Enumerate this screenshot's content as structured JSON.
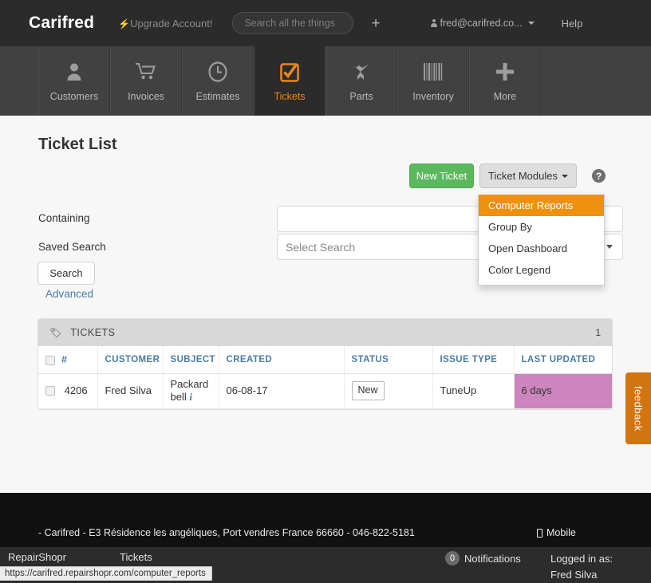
{
  "header": {
    "brand": "Carifred",
    "upgrade_label": "Upgrade Account!",
    "search_placeholder": "Search all the things",
    "plus_label": "+",
    "account_email": "fred@carifred.co...",
    "help_label": "Help"
  },
  "nav": {
    "items": [
      {
        "label": "Customers",
        "icon": "user-icon",
        "active": false
      },
      {
        "label": "Invoices",
        "icon": "cart-icon",
        "active": false
      },
      {
        "label": "Estimates",
        "icon": "clock-icon",
        "active": false
      },
      {
        "label": "Tickets",
        "icon": "checked-box-icon",
        "active": true
      },
      {
        "label": "Parts",
        "icon": "airplane-icon",
        "active": false
      },
      {
        "label": "Inventory",
        "icon": "barcode-icon",
        "active": false
      },
      {
        "label": "More",
        "icon": "plus-icon",
        "active": false
      }
    ]
  },
  "main": {
    "page_title": "Ticket List",
    "new_ticket_label": "New Ticket",
    "ticket_modules_label": "Ticket Modules",
    "help_icon_label": "?",
    "dropdown": {
      "items": [
        {
          "label": "Computer Reports",
          "highlighted": true
        },
        {
          "label": "Group By",
          "highlighted": false
        },
        {
          "label": "Open Dashboard",
          "highlighted": false
        },
        {
          "label": "Color Legend",
          "highlighted": false
        }
      ]
    },
    "form": {
      "containing_label": "Containing",
      "containing_value": "",
      "containing_placeholder": "",
      "saved_search_label": "Saved Search",
      "saved_search_value": "Select Search",
      "search_button": "Search",
      "advanced_link": "Advanced"
    },
    "panel": {
      "title": "TICKETS",
      "count": "1",
      "columns": [
        "#",
        "CUSTOMER",
        "SUBJECT",
        "CREATED",
        "STATUS",
        "ISSUE TYPE",
        "LAST UPDATED"
      ],
      "rows": [
        {
          "number": "4206",
          "customer": "Fred Silva",
          "subject": "Packard bell",
          "created": "06-08-17",
          "status": "New",
          "issue_type": "TuneUp",
          "last_updated": "6 days"
        }
      ]
    },
    "feedback_label": "feedback"
  },
  "footer": {
    "address": "- Carifred - E3 Résidence les angéliques, Port vendres France 66660 - 046-822-5181",
    "mobile_label": "Mobile"
  },
  "statusbar": {
    "app_name": "RepairShopr",
    "tab_name": "Tickets",
    "notifications_count": "0",
    "notifications_label": "Notifications",
    "logged_in_label": "Logged in as:",
    "logged_in_user": "Fred Silva",
    "link_url": "https://carifred.repairshopr.com/computer_reports"
  },
  "colors": {
    "accent_orange": "#f0900f",
    "green": "#5cb85c",
    "pink": "#cc85bd",
    "link_blue": "#4a7ba7",
    "dark_header": "#2b2b2b",
    "nav_bg": "#414141"
  }
}
